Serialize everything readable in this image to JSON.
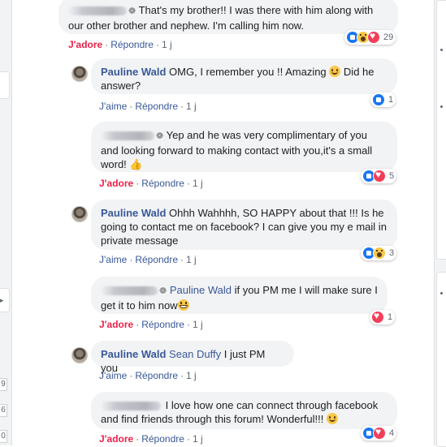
{
  "left_digits": [
    "9",
    "6",
    "0"
  ],
  "comments": [
    {
      "id": "c1",
      "blurred_name": true,
      "text": "That's my brother!! I was there with him along with our other brother and nephew. I'm calling him now.",
      "actions": {
        "react": "J'adore",
        "react_active": true,
        "reply": "Répondre",
        "time": "1 j"
      },
      "reactions": [
        "like",
        "wow",
        "love"
      ],
      "reaction_count": "29"
    },
    {
      "id": "c2",
      "author": "Pauline Wald",
      "text": "OMG, I remember you !! Amazing",
      "text_after": "Did he answer?",
      "actions": {
        "react": "J'aime",
        "react_active": false,
        "reply": "Répondre",
        "time": "1 j"
      },
      "reactions": [
        "like"
      ],
      "reaction_count": "1"
    },
    {
      "id": "c3",
      "blurred_name": true,
      "text": "Yep and he was very complimentary of you and looking forward to making contact with you,it's a small word!",
      "actions": {
        "react": "J'adore",
        "react_active": true,
        "reply": "Répondre",
        "time": "1 j"
      },
      "reactions": [
        "like",
        "love"
      ],
      "reaction_count": "5"
    },
    {
      "id": "c4",
      "author": "Pauline Wald",
      "text": "Ohhh Wahhhh, SO HAPPY about that !!! Is he going to contact me on facebook? I can give you my e mail in private message",
      "actions": {
        "react": "J'aime",
        "react_active": false,
        "reply": "Répondre",
        "time": "1 j"
      },
      "reactions": [
        "like",
        "wow"
      ],
      "reaction_count": "3"
    },
    {
      "id": "c5",
      "blurred_name": true,
      "mention": "Pauline Wald",
      "text": "if you PM me I will make sure I get it to him now",
      "actions": {
        "react": "J'adore",
        "react_active": true,
        "reply": "Répondre",
        "time": "1 j"
      },
      "reactions": [
        "love"
      ],
      "reaction_count": "1"
    },
    {
      "id": "c6",
      "author": "Pauline Wald",
      "mention": "Sean Duffy",
      "text": "I just PM you",
      "actions": {
        "react": "J'aime",
        "react_active": false,
        "reply": "Répondre",
        "time": "1 j"
      }
    },
    {
      "id": "c7",
      "blurred_name": true,
      "text": "I love how one can connect through facebook and find friends through this forum! Wonderful!!!",
      "actions": {
        "react": "J'adore",
        "react_active": true,
        "reply": "Répondre",
        "time": "1 j"
      },
      "reactions": [
        "like",
        "love"
      ],
      "reaction_count": "4"
    }
  ],
  "colors": {
    "link": "#385898",
    "jadore": "#e9224b",
    "bubble": "#f2f3f5",
    "like": "#1877f2",
    "love": "#f33e58",
    "wow": "#f7c84b"
  }
}
